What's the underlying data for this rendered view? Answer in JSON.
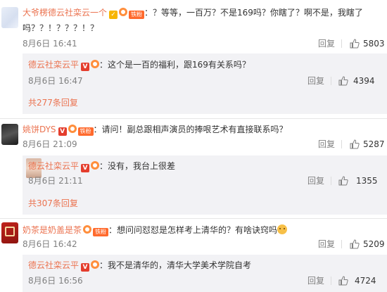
{
  "comments": [
    {
      "user": "大爷楞德云社栾云一个",
      "text_line1": "：？等等，一百万？不是169吗？你瞎了？啊不是，我瞎了",
      "text_line2": "吗？？！？？？！？",
      "level": "铁粉",
      "date": "8月6日 16:41",
      "reply_label": "回复",
      "likes": "5803",
      "reply": {
        "user": "德云社栾云平",
        "text": "：这个是一百的福利，跟169有关系吗？",
        "date": "8月6日 16:47",
        "reply_label": "回复",
        "likes": "4394"
      },
      "more": "共277条回复"
    },
    {
      "user": "姚饼DYS",
      "text": "：请问！副总跟相声演员的捧哏艺术有直接联系吗？",
      "level": "铁粉",
      "date": "8月6日 21:09",
      "reply_label": "回复",
      "likes": "5287",
      "reply": {
        "user": "德云社栾云平",
        "text": "：没有，我台上很差",
        "date": "8月6日 21:11",
        "reply_label": "回复",
        "likes": "1355"
      },
      "more": "共307条回复"
    },
    {
      "user": "奶茶是奶盖是茶",
      "text": "：想问问怼怼是怎样考上清华的？有啥诀窍吗",
      "level": "铁粉",
      "date": "8月6日 16:42",
      "reply_label": "回复",
      "likes": "5209",
      "reply": {
        "user": "德云社栾云平",
        "text": "：我不是清华的，清华大学美术学院自考",
        "date": "8月6日 16:56",
        "reply_label": "回复",
        "likes": "4724"
      }
    }
  ],
  "colors": {
    "username": "#eb7350",
    "text": "#333333",
    "meta": "#808080",
    "reply_bg": "#f2f2f5"
  },
  "icons": {
    "verified": "vip-badge-icon",
    "like": "thumbs-up-icon"
  }
}
